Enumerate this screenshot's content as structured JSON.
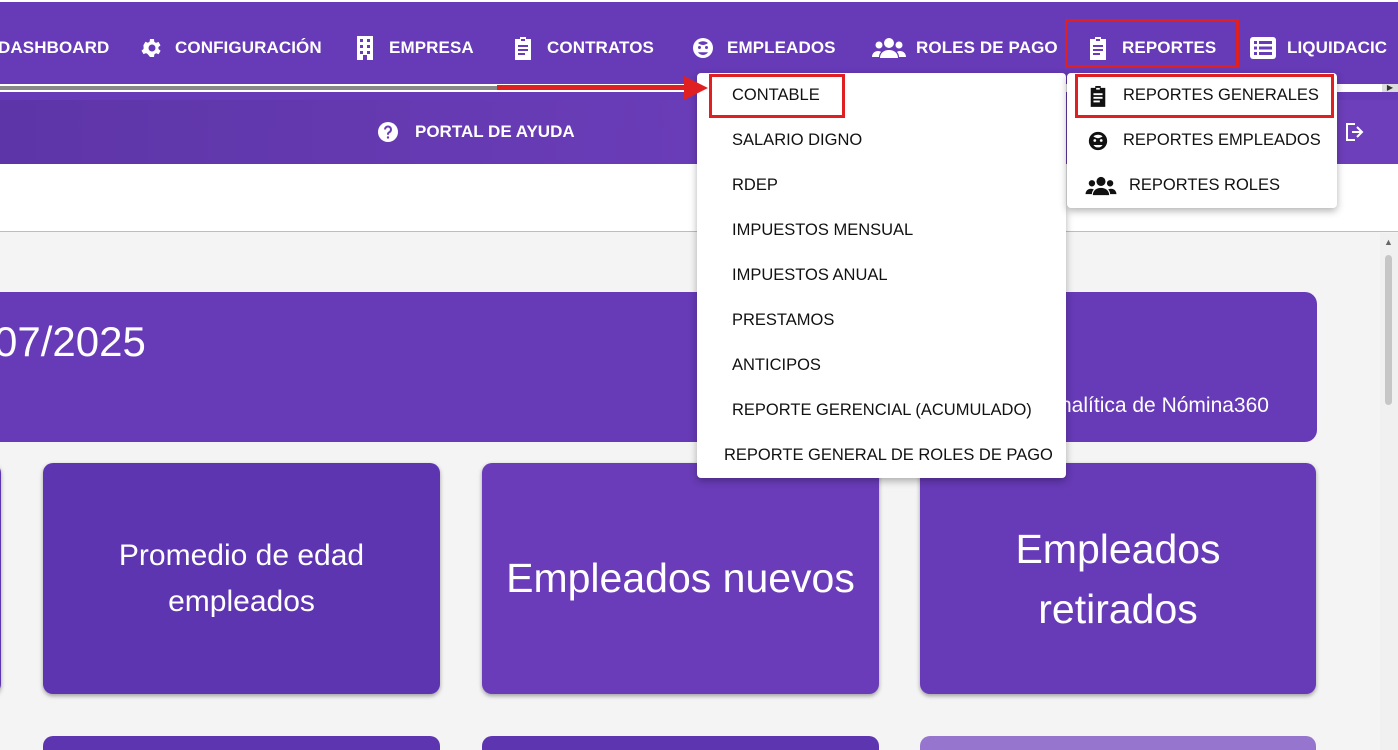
{
  "nav": {
    "items": [
      {
        "label": "DASHBOARD",
        "icon": "dashboard-icon"
      },
      {
        "label": "CONFIGURACIÓN",
        "icon": "gear-icon"
      },
      {
        "label": "EMPRESA",
        "icon": "building-icon"
      },
      {
        "label": "CONTRATOS",
        "icon": "clipboard-icon"
      },
      {
        "label": "EMPLEADOS",
        "icon": "face-icon"
      },
      {
        "label": "ROLES DE PAGO",
        "icon": "people-icon"
      },
      {
        "label": "REPORTES",
        "icon": "clipboard-icon"
      },
      {
        "label": "LIQUIDACIC",
        "icon": "list-icon"
      }
    ]
  },
  "subnav": {
    "help_label": "PORTAL DE AYUDA"
  },
  "banner": {
    "date": "07/2025",
    "subtitle": "nalítica de Nómina360"
  },
  "cards": [
    {
      "title": "Promedio de edad empleados"
    },
    {
      "title": "Empleados nuevos"
    },
    {
      "title": "Empleados retirados"
    }
  ],
  "reportes_menu": {
    "items": [
      {
        "label": "CONTABLE"
      },
      {
        "label": "SALARIO DIGNO"
      },
      {
        "label": "RDEP"
      },
      {
        "label": "IMPUESTOS MENSUAL"
      },
      {
        "label": "IMPUESTOS ANUAL"
      },
      {
        "label": "PRESTAMOS"
      },
      {
        "label": "ANTICIPOS"
      },
      {
        "label": "REPORTE GERENCIAL (ACUMULADO)"
      },
      {
        "label": "REPORTE GENERAL DE ROLES DE PAGO"
      }
    ]
  },
  "reportes_submenu": {
    "items": [
      {
        "label": "REPORTES GENERALES",
        "icon": "clipboard-icon"
      },
      {
        "label": "REPORTES EMPLEADOS",
        "icon": "face-icon"
      },
      {
        "label": "REPORTES ROLES",
        "icon": "people-icon"
      }
    ]
  },
  "colors": {
    "primary": "#673ab7",
    "highlight": "#e02020"
  }
}
